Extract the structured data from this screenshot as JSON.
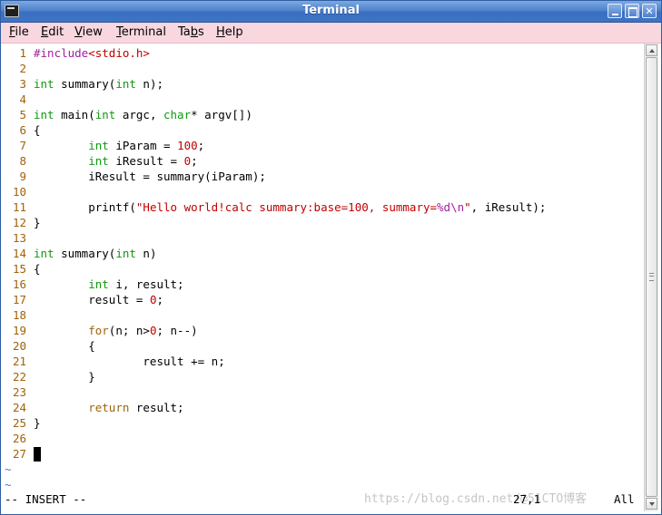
{
  "window": {
    "title": "Terminal",
    "buttons": {
      "minimize": "",
      "maximize": "",
      "close": "✕"
    }
  },
  "menu": [
    {
      "pre": "",
      "acc": "F",
      "post": "ile"
    },
    {
      "pre": "",
      "acc": "E",
      "post": "dit"
    },
    {
      "pre": "",
      "acc": "V",
      "post": "iew"
    },
    {
      "pre": "",
      "acc": "T",
      "post": "erminal"
    },
    {
      "pre": "Ta",
      "acc": "b",
      "post": "s"
    },
    {
      "pre": "",
      "acc": "H",
      "post": "elp"
    }
  ],
  "colors": {
    "keyword": "#119911",
    "control": "#a0620b",
    "preproc": "#a020a0",
    "string": "#c00000",
    "number": "#c00000",
    "linenumber": "#a0620b",
    "tilde": "#4d7fd6"
  },
  "code": [
    {
      "n": "1",
      "t": [
        [
          "#include",
          "preproc"
        ],
        [
          "<stdio.h>",
          "string"
        ]
      ]
    },
    {
      "n": "2",
      "t": []
    },
    {
      "n": "3",
      "t": [
        [
          "int",
          "keyword"
        ],
        [
          " summary(",
          ""
        ],
        [
          "int",
          "keyword"
        ],
        [
          " n);",
          ""
        ]
      ]
    },
    {
      "n": "4",
      "t": []
    },
    {
      "n": "5",
      "t": [
        [
          "int",
          "keyword"
        ],
        [
          " main(",
          ""
        ],
        [
          "int",
          "keyword"
        ],
        [
          " argc, ",
          ""
        ],
        [
          "char",
          "keyword"
        ],
        [
          "* argv[])",
          ""
        ]
      ]
    },
    {
      "n": "6",
      "t": [
        [
          "{",
          ""
        ]
      ]
    },
    {
      "n": "7",
      "t": [
        [
          "        ",
          ""
        ],
        [
          "int",
          "keyword"
        ],
        [
          " iParam = ",
          ""
        ],
        [
          "100",
          "number"
        ],
        [
          ";",
          ""
        ]
      ]
    },
    {
      "n": "8",
      "t": [
        [
          "        ",
          ""
        ],
        [
          "int",
          "keyword"
        ],
        [
          " iResult = ",
          ""
        ],
        [
          "0",
          "number"
        ],
        [
          ";",
          ""
        ]
      ]
    },
    {
      "n": "9",
      "t": [
        [
          "        iResult = summary(iParam);",
          ""
        ]
      ]
    },
    {
      "n": "10",
      "t": []
    },
    {
      "n": "11",
      "t": [
        [
          "        printf(",
          ""
        ],
        [
          "\"Hello world!calc summary:base=100, summary=",
          "string"
        ],
        [
          "%d\\n",
          "preproc"
        ],
        [
          "\"",
          "string"
        ],
        [
          ", iResult);",
          ""
        ]
      ]
    },
    {
      "n": "12",
      "t": [
        [
          "}",
          ""
        ]
      ]
    },
    {
      "n": "13",
      "t": []
    },
    {
      "n": "14",
      "t": [
        [
          "int",
          "keyword"
        ],
        [
          " summary(",
          ""
        ],
        [
          "int",
          "keyword"
        ],
        [
          " n)",
          ""
        ]
      ]
    },
    {
      "n": "15",
      "t": [
        [
          "{",
          ""
        ]
      ]
    },
    {
      "n": "16",
      "t": [
        [
          "        ",
          ""
        ],
        [
          "int",
          "keyword"
        ],
        [
          " i, result;",
          ""
        ]
      ]
    },
    {
      "n": "17",
      "t": [
        [
          "        result = ",
          ""
        ],
        [
          "0",
          "number"
        ],
        [
          ";",
          ""
        ]
      ]
    },
    {
      "n": "18",
      "t": []
    },
    {
      "n": "19",
      "t": [
        [
          "        ",
          ""
        ],
        [
          "for",
          "control"
        ],
        [
          "(n; n>",
          ""
        ],
        [
          "0",
          "number"
        ],
        [
          "; n--)",
          ""
        ]
      ]
    },
    {
      "n": "20",
      "t": [
        [
          "        {",
          ""
        ]
      ]
    },
    {
      "n": "21",
      "t": [
        [
          "                result += n;",
          ""
        ]
      ]
    },
    {
      "n": "22",
      "t": [
        [
          "        }",
          ""
        ]
      ]
    },
    {
      "n": "23",
      "t": []
    },
    {
      "n": "24",
      "t": [
        [
          "        ",
          ""
        ],
        [
          "return",
          "control"
        ],
        [
          " result;",
          ""
        ]
      ]
    },
    {
      "n": "25",
      "t": [
        [
          "}",
          ""
        ]
      ]
    },
    {
      "n": "26",
      "t": []
    },
    {
      "n": "27",
      "t": [],
      "cursor": true
    }
  ],
  "tildes": [
    "~",
    "~"
  ],
  "status": {
    "mode": "-- INSERT --",
    "position": "27,1",
    "scroll": "All",
    "watermark": "https://blog.csdn.net/@51CTO博客"
  }
}
